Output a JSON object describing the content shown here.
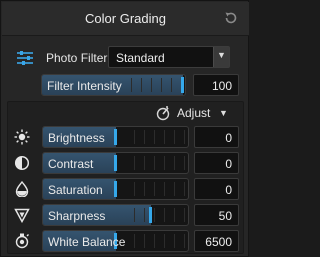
{
  "panel": {
    "title": "Color Grading",
    "reset_icon": "reset-icon"
  },
  "filter": {
    "label": "Photo Filter",
    "selected": "Standard",
    "icon": "sliders-icon"
  },
  "intensity": {
    "label": "Filter Intensity",
    "value": "100",
    "level": 1.0
  },
  "adjust": {
    "label": "Adjust",
    "icon": "adjust-wand-icon"
  },
  "adjustments": [
    {
      "label": "Brightness",
      "value": "0",
      "icon": "sun-icon",
      "level": 0.5
    },
    {
      "label": "Contrast",
      "value": "0",
      "icon": "contrast-icon",
      "level": 0.5
    },
    {
      "label": "Saturation",
      "value": "0",
      "icon": "droplet-icon",
      "level": 0.5
    },
    {
      "label": "Sharpness",
      "value": "50",
      "icon": "sharpness-triangle-icon",
      "level": 0.75
    },
    {
      "label": "White Balance",
      "value": "6500",
      "icon": "thermometer-icon",
      "level": 0.5
    }
  ],
  "colors": {
    "accent": "#35a8ea",
    "fill": "#2f4b64"
  }
}
